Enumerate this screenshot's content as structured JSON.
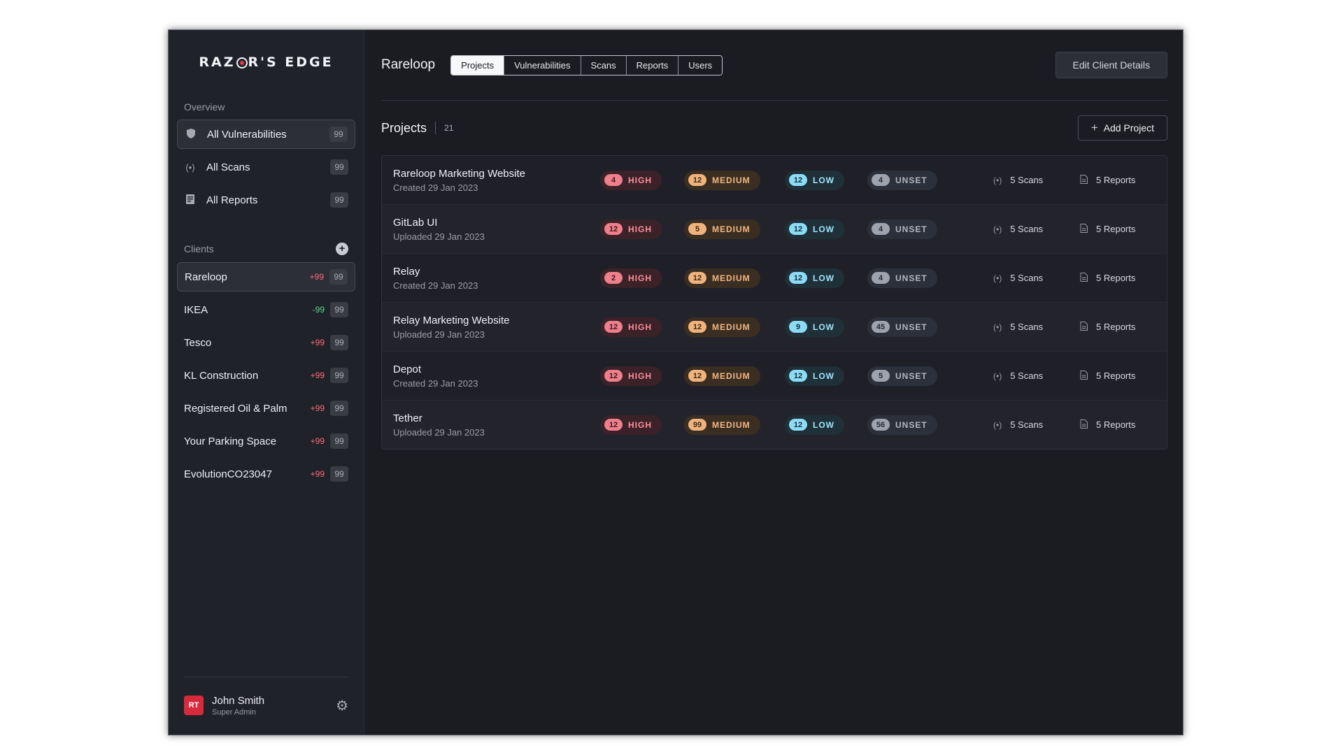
{
  "logo": {
    "pre": "RAZ",
    "post": "R'S EDGE"
  },
  "sidebar": {
    "overview_label": "Overview",
    "overview_items": [
      {
        "label": "All Vulnerabilities",
        "count": "99",
        "icon": "shield-icon"
      },
      {
        "label": "All Scans",
        "count": "99",
        "icon": "signal-icon"
      },
      {
        "label": "All Reports",
        "count": "99",
        "icon": "report-icon"
      }
    ],
    "clients_label": "Clients",
    "add_client_glyph": "+",
    "clients": [
      {
        "name": "Rareloop",
        "delta": "+99",
        "count": "99"
      },
      {
        "name": "IKEA",
        "delta": "-99",
        "count": "99"
      },
      {
        "name": "Tesco",
        "delta": "+99",
        "count": "99"
      },
      {
        "name": "KL Construction",
        "delta": "+99",
        "count": "99"
      },
      {
        "name": "Registered Oil & Palm",
        "delta": "+99",
        "count": "99"
      },
      {
        "name": "Your Parking Space",
        "delta": "+99",
        "count": "99"
      },
      {
        "name": "EvolutionCO23047",
        "delta": "+99",
        "count": "99"
      }
    ],
    "user": {
      "initials": "RT",
      "name": "John Smith",
      "role": "Super Admin"
    }
  },
  "header": {
    "client_name": "Rareloop",
    "tabs": [
      "Projects",
      "Vulnerabilities",
      "Scans",
      "Reports",
      "Users"
    ],
    "edit_button": "Edit Client Details"
  },
  "projects": {
    "title": "Projects",
    "count": "21",
    "add_button": "Add Project",
    "severity_labels": {
      "high": "HIGH",
      "medium": "MEDIUM",
      "low": "LOW",
      "unset": "UNSET"
    },
    "rows": [
      {
        "name": "Rareloop Marketing Website",
        "date": "Created 29 Jan 2023",
        "high": "4",
        "medium": "12",
        "low": "12",
        "unset": "4",
        "scans": "5 Scans",
        "reports": "5 Reports"
      },
      {
        "name": "GitLab UI",
        "date": "Uploaded 29 Jan 2023",
        "high": "12",
        "medium": "5",
        "low": "12",
        "unset": "4",
        "scans": "5 Scans",
        "reports": "5 Reports"
      },
      {
        "name": "Relay",
        "date": "Created 29 Jan 2023",
        "high": "2",
        "medium": "12",
        "low": "12",
        "unset": "4",
        "scans": "5 Scans",
        "reports": "5 Reports"
      },
      {
        "name": "Relay Marketing Website",
        "date": "Uploaded 29 Jan 2023",
        "high": "12",
        "medium": "12",
        "low": "9",
        "unset": "45",
        "scans": "5 Scans",
        "reports": "5 Reports"
      },
      {
        "name": "Depot",
        "date": "Created 29 Jan 2023",
        "high": "12",
        "medium": "12",
        "low": "12",
        "unset": "5",
        "scans": "5 Scans",
        "reports": "5 Reports"
      },
      {
        "name": "Tether",
        "date": "Uploaded 29 Jan 2023",
        "high": "12",
        "medium": "99",
        "low": "12",
        "unset": "56",
        "scans": "5 Scans",
        "reports": "5 Reports"
      }
    ]
  },
  "colors": {
    "accent_red": "#d9293d",
    "high": "#f07f8c",
    "medium": "#f0b37c",
    "low": "#8ddcf5",
    "unset": "#9ea3b0"
  }
}
